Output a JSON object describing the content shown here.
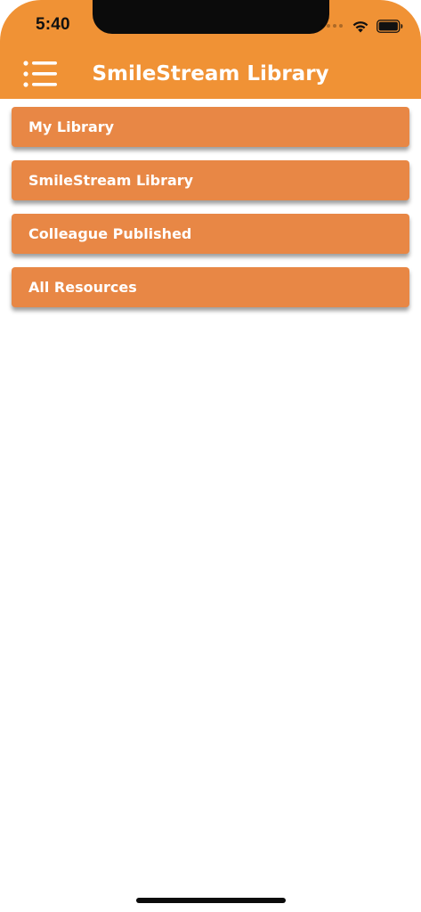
{
  "status_bar": {
    "time": "5:40",
    "icons": [
      "signal-dots-icon",
      "wifi-icon",
      "battery-icon"
    ]
  },
  "header": {
    "title": "SmileStream Library",
    "menu_icon": "hamburger-menu-icon",
    "background": "#f09235"
  },
  "menu": {
    "items": [
      {
        "label": "My Library"
      },
      {
        "label": "SmileStream Library"
      },
      {
        "label": "Colleague Published"
      },
      {
        "label": "All Resources"
      }
    ],
    "item_color": "#e88745",
    "text_color": "#ffffff"
  }
}
